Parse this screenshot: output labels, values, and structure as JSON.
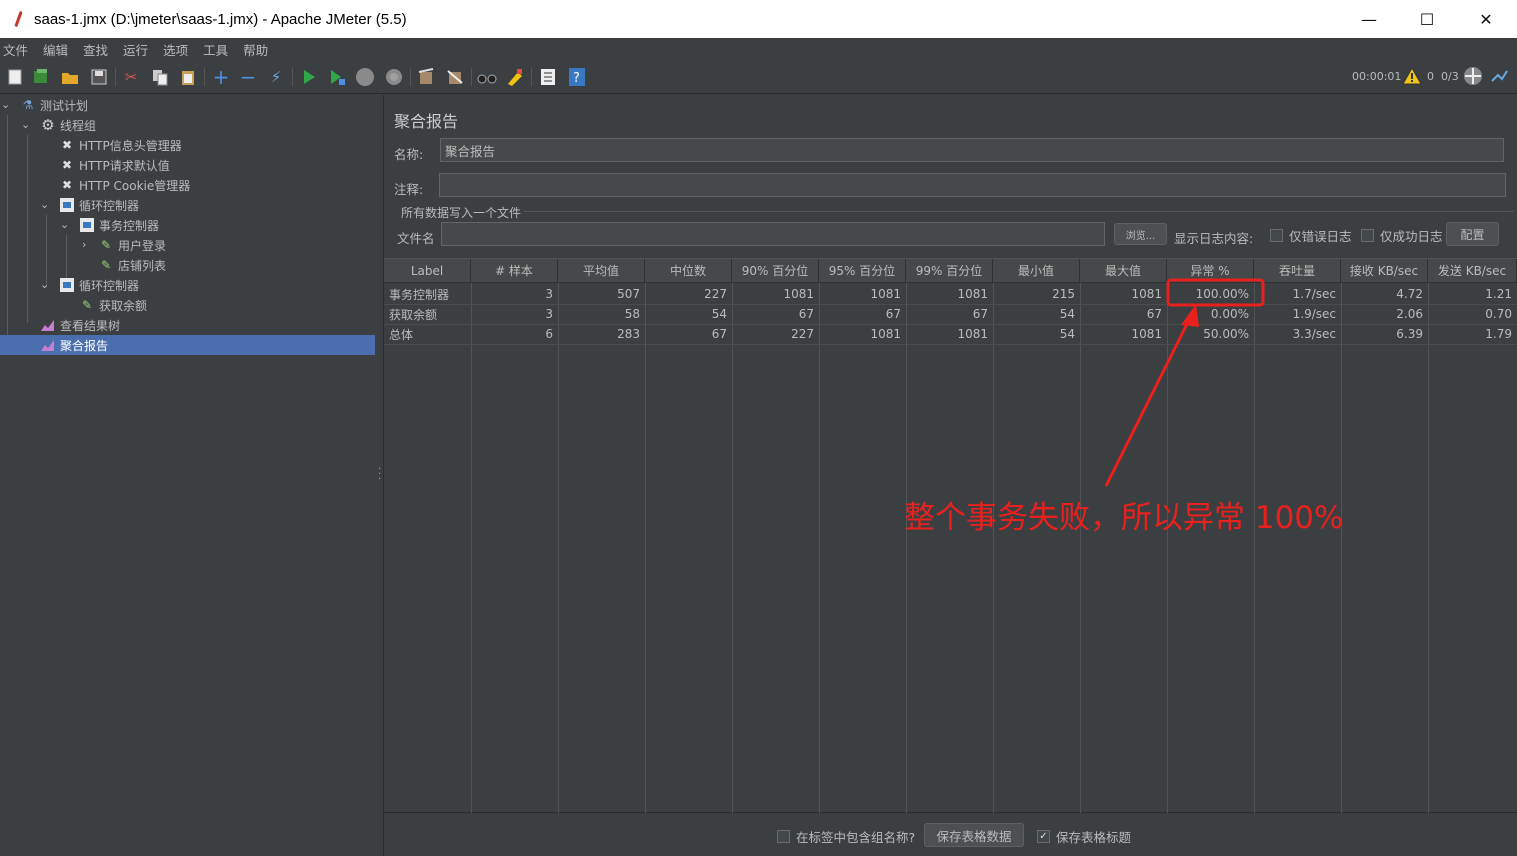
{
  "window": {
    "title": "saas-1.jmx (D:\\jmeter\\saas-1.jmx) - Apache JMeter (5.5)",
    "minimize": "—",
    "maximize": "☐",
    "close": "✕"
  },
  "menu": [
    "文件",
    "编辑",
    "查找",
    "运行",
    "选项",
    "工具",
    "帮助"
  ],
  "toolbar": {
    "timer": "00:00:01",
    "warnings": "0",
    "threads": "0/3"
  },
  "tree": {
    "items": [
      {
        "label": "测试计划",
        "icon": "flask-icon"
      },
      {
        "label": "线程组",
        "icon": "gear-icon"
      },
      {
        "label": "HTTP信息头管理器",
        "icon": "wrench-icon"
      },
      {
        "label": "HTTP请求默认值",
        "icon": "wrench-icon"
      },
      {
        "label": "HTTP Cookie管理器",
        "icon": "wrench-icon"
      },
      {
        "label": "循环控制器",
        "icon": "controller-icon"
      },
      {
        "label": "事务控制器",
        "icon": "controller-icon"
      },
      {
        "label": "用户登录",
        "icon": "sampler-icon"
      },
      {
        "label": "店铺列表",
        "icon": "sampler-icon"
      },
      {
        "label": "循环控制器",
        "icon": "controller-icon"
      },
      {
        "label": "获取余额",
        "icon": "sampler-icon"
      },
      {
        "label": "查看结果树",
        "icon": "listener-icon"
      },
      {
        "label": "聚合报告",
        "icon": "listener-icon"
      }
    ]
  },
  "panel": {
    "title": "聚合报告",
    "name_label": "名称:",
    "name_value": "聚合报告",
    "comment_label": "注释:",
    "comment_value": "",
    "file_section": "所有数据写入一个文件",
    "file_label": "文件名",
    "file_value": "",
    "browse": "浏览...",
    "log_label": "显示日志内容:",
    "errors_only": "仅错误日志",
    "success_only": "仅成功日志",
    "configure": "配置"
  },
  "table": {
    "headers": [
      "Label",
      "# 样本",
      "平均值",
      "中位数",
      "90% 百分位",
      "95% 百分位",
      "99% 百分位",
      "最小值",
      "最大值",
      "异常 %",
      "吞吐量",
      "接收 KB/sec",
      "发送 KB/sec"
    ],
    "rows": [
      [
        "事务控制器",
        "3",
        "507",
        "227",
        "1081",
        "1081",
        "1081",
        "215",
        "1081",
        "100.00%",
        "1.7/sec",
        "4.72",
        "1.21"
      ],
      [
        "获取余额",
        "3",
        "58",
        "54",
        "67",
        "67",
        "67",
        "54",
        "67",
        "0.00%",
        "1.9/sec",
        "2.06",
        "0.70"
      ],
      [
        "总体",
        "6",
        "283",
        "67",
        "227",
        "1081",
        "1081",
        "54",
        "1081",
        "50.00%",
        "3.3/sec",
        "6.39",
        "1.79"
      ]
    ]
  },
  "bottom": {
    "include_group": "在标签中包含组名称?",
    "save_data": "保存表格数据",
    "save_header": "保存表格标题"
  },
  "annotation": {
    "text": "整个事务失败，所以异常 100%",
    "color": "#e8211e"
  }
}
